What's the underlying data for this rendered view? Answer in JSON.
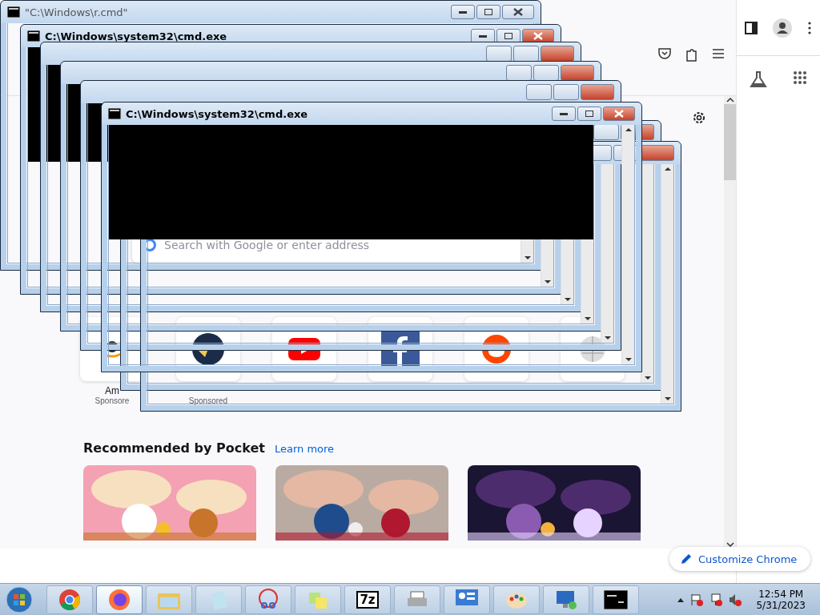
{
  "browser": {
    "search": {
      "placeholder": "Search with Google or enter address"
    },
    "tiles": [
      {
        "kind": "amazon",
        "title": "Am",
        "sponsor": "Sponsore"
      },
      {
        "kind": "plane",
        "sponsor": "Sponsored"
      },
      {
        "kind": "youtube"
      },
      {
        "kind": "facebook"
      },
      {
        "kind": "reddit"
      },
      {
        "kind": "wikipedia"
      }
    ],
    "pocket": {
      "heading": "Recommended by Pocket",
      "link": "Learn more"
    },
    "customize_button": "Customize Chrome"
  },
  "windows": [
    {
      "kind": "window",
      "title": "\"C:\\Windows\\r.cmd\"",
      "active": false
    },
    {
      "kind": "window",
      "title": "C:\\Windows\\system32\\cmd.exe",
      "active": true,
      "console": true
    },
    {
      "kind": "frame"
    },
    {
      "kind": "frame"
    },
    {
      "kind": "frame"
    },
    {
      "kind": "frame"
    },
    {
      "kind": "frame"
    },
    {
      "kind": "window",
      "title": "C:\\Windows\\system32\\cmd.exe",
      "active": true,
      "console": true
    }
  ],
  "taskbar": {
    "apps": [
      {
        "kind": "chrome",
        "selected": false
      },
      {
        "kind": "firefox",
        "selected": true
      },
      {
        "kind": "explorer",
        "selected": false
      },
      {
        "kind": "notepad",
        "selected": false
      },
      {
        "kind": "snipping",
        "selected": false
      },
      {
        "kind": "notes",
        "selected": false
      },
      {
        "kind": "archiver",
        "label": "7z",
        "selected": false
      },
      {
        "kind": "printer",
        "selected": false
      },
      {
        "kind": "control",
        "selected": false
      },
      {
        "kind": "paint",
        "selected": false
      },
      {
        "kind": "remote",
        "selected": false
      },
      {
        "kind": "console",
        "selected": false
      }
    ],
    "time": "12:54 PM",
    "date": "5/31/2023"
  }
}
